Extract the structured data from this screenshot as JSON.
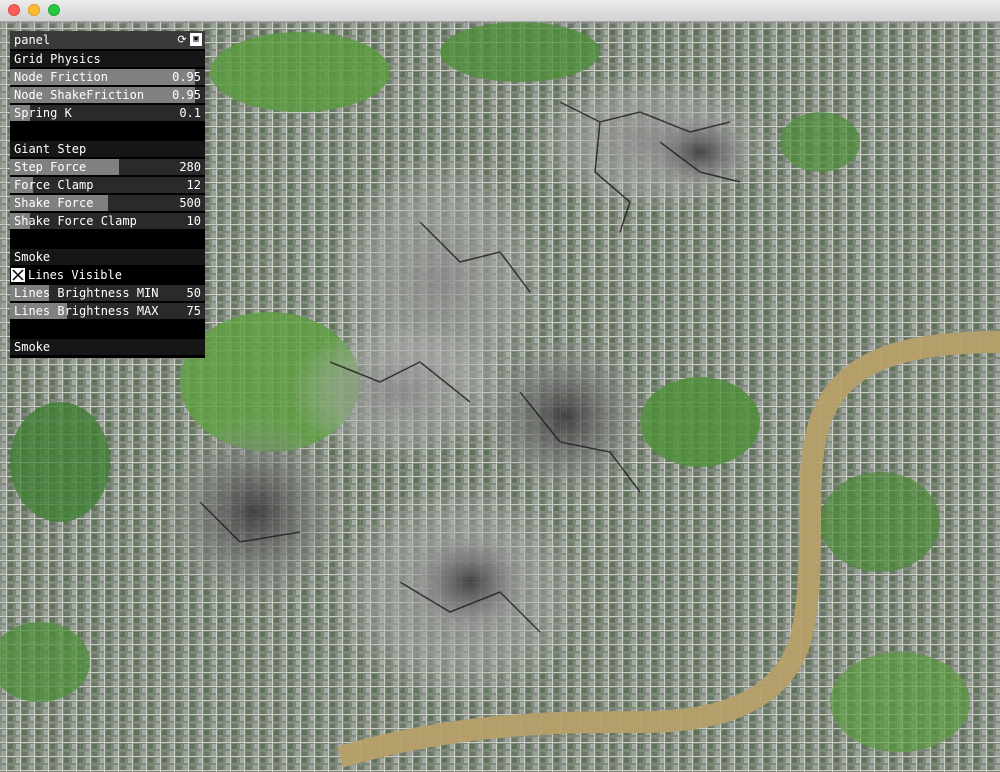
{
  "panel": {
    "title": "panel",
    "groups": [
      {
        "title": "Grid Physics",
        "controls": [
          {
            "label": "Node Friction",
            "value": "0.95",
            "level": 0.95
          },
          {
            "label": "Node ShakeFriction",
            "value": "0.95",
            "level": 0.95
          },
          {
            "label": "Spring K",
            "value": "0.1",
            "level": 0.1
          }
        ]
      },
      {
        "title": "Giant Step",
        "controls": [
          {
            "label": "Step Force",
            "value": "280",
            "level": 0.56
          },
          {
            "label": "Force Clamp",
            "value": "12",
            "level": 0.12
          },
          {
            "label": "Shake Force",
            "value": "500",
            "level": 0.5
          },
          {
            "label": "Shake Force Clamp",
            "value": "10",
            "level": 0.1
          }
        ]
      },
      {
        "title": "Smoke",
        "toggle": {
          "label": "Lines Visible",
          "checked": true
        },
        "controls": [
          {
            "label": "Lines Brightness MIN",
            "value": "50",
            "level": 0.2
          },
          {
            "label": "Lines Brightness MAX",
            "value": "75",
            "level": 0.29
          }
        ]
      },
      {
        "title": "Smoke",
        "controls": []
      }
    ]
  },
  "icons": {
    "reload": "reload-icon",
    "save": "save-icon",
    "close": "close-button",
    "minimize": "minimize-button",
    "zoom": "zoom-button"
  },
  "colors": {
    "panel_bg": "#000000",
    "slider_fill": "#808080",
    "river": "#b49e6a",
    "park": "#4e8f3a",
    "urban": "#8a9088"
  }
}
